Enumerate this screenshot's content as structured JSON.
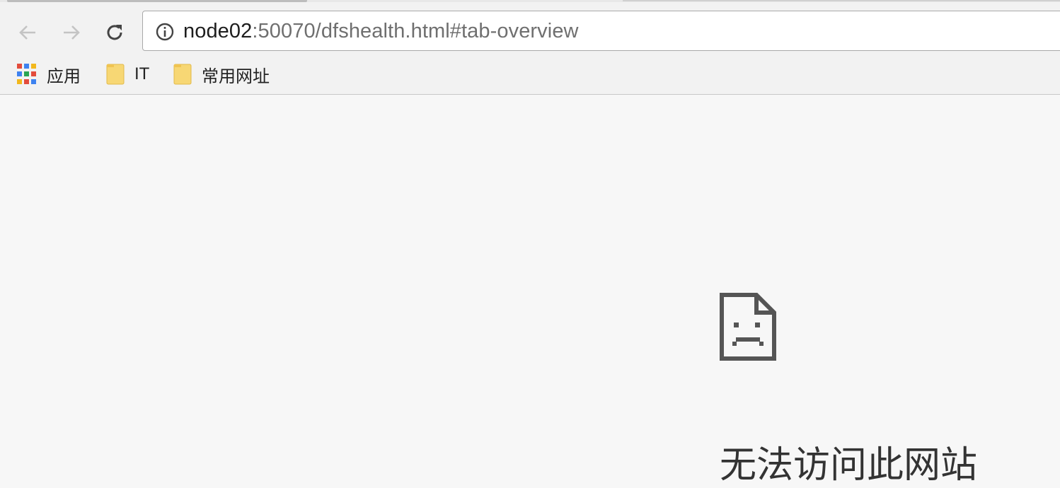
{
  "browser": {
    "address_bar": {
      "host": "node02",
      "rest": ":50070/dfshealth.html#tab-overview"
    },
    "bookmarks": [
      {
        "label": "应用",
        "icon": "apps-grid-icon"
      },
      {
        "label": "IT",
        "icon": "folder-icon"
      },
      {
        "label": "常用网址",
        "icon": "folder-icon"
      }
    ],
    "colors": {
      "toolbar": "#f2f2f2",
      "page_bg": "#f7f7f7",
      "folder": "#f7d774"
    }
  },
  "error_page": {
    "icon": "sad-page-icon",
    "title": "无法访问此网站"
  }
}
